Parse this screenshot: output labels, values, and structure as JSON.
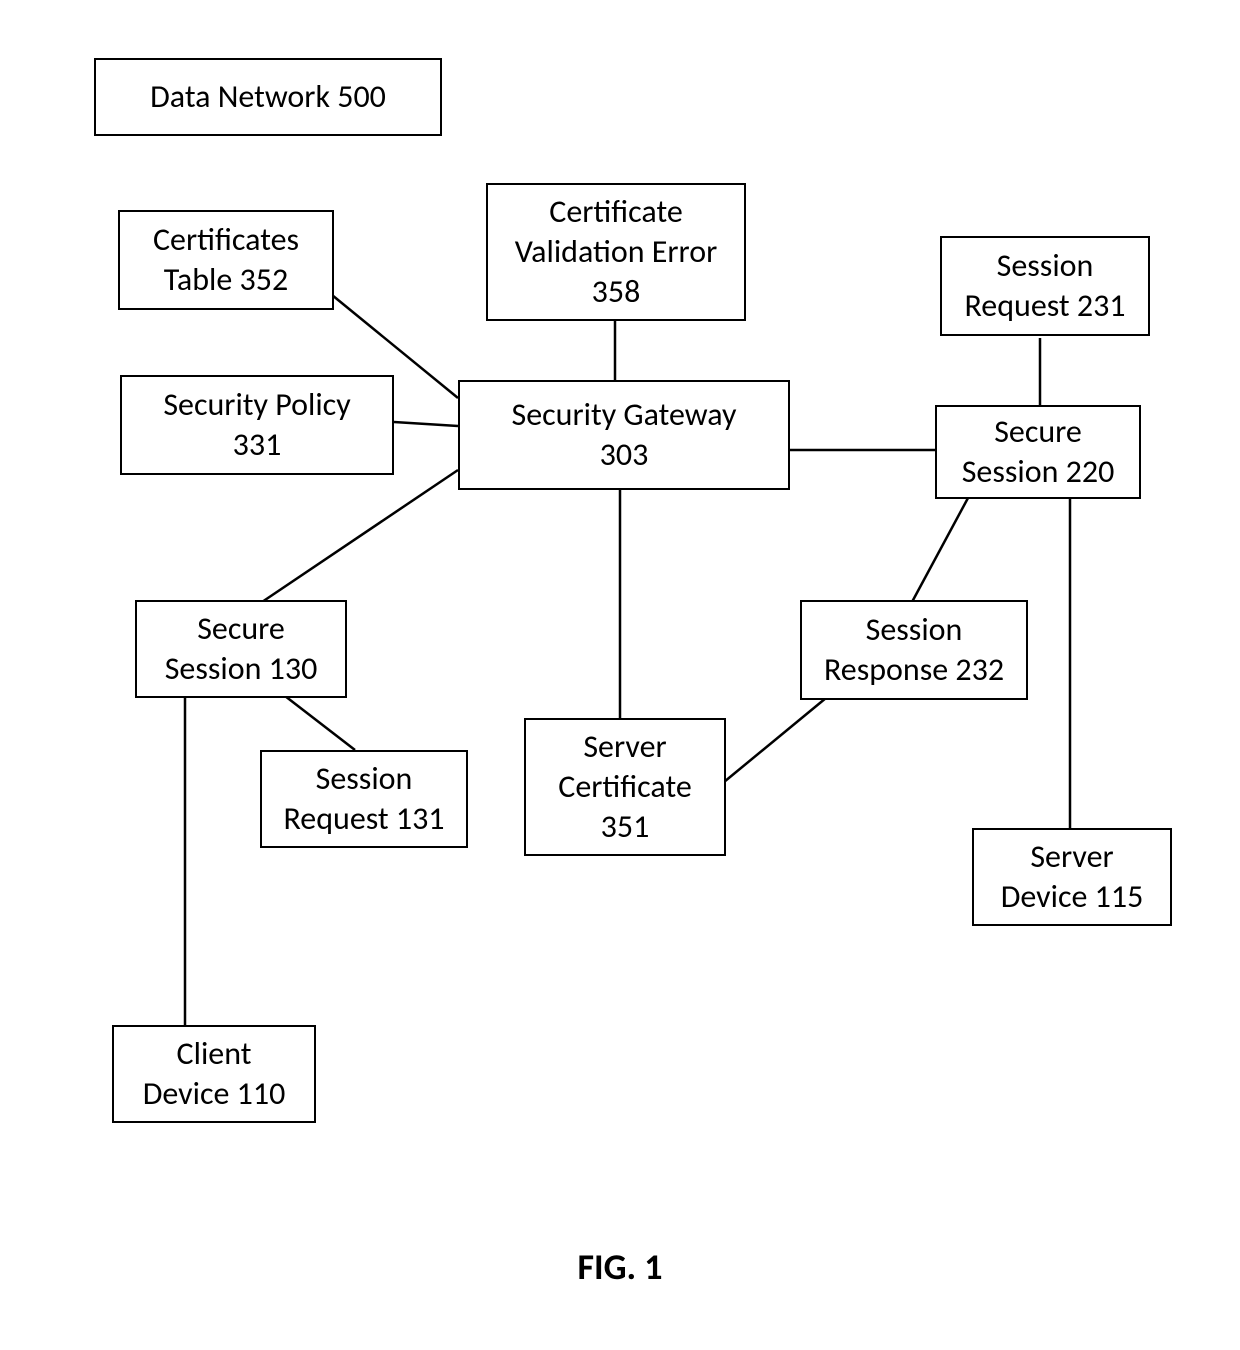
{
  "caption": "FIG. 1",
  "nodes": {
    "dataNetwork": {
      "line1": "Data Network 500"
    },
    "certTable": {
      "line1": "Certificates",
      "line2": "Table 352"
    },
    "certValErr": {
      "line1": "Certificate",
      "line2": "Validation Error",
      "line3": "358"
    },
    "sessReq231": {
      "line1": "Session",
      "line2": "Request 231"
    },
    "secPolicy": {
      "line1": "Security Policy",
      "line2": "331"
    },
    "secGateway": {
      "line1": "Security Gateway",
      "line2": "303"
    },
    "secSess220": {
      "line1": "Secure",
      "line2": "Session 220"
    },
    "secSess130": {
      "line1": "Secure",
      "line2": "Session 130"
    },
    "sessResp232": {
      "line1": "Session",
      "line2": "Response 232"
    },
    "sessReq131": {
      "line1": "Session",
      "line2": "Request 131"
    },
    "servCert": {
      "line1": "Server",
      "line2": "Certificate",
      "line3": "351"
    },
    "servDev": {
      "line1": "Server",
      "line2": "Device 115"
    },
    "clientDev": {
      "line1": "Client",
      "line2": "Device 110"
    }
  },
  "edges": [
    {
      "from": "certTable",
      "to": "secGateway"
    },
    {
      "from": "certValErr",
      "to": "secGateway"
    },
    {
      "from": "secPolicy",
      "to": "secGateway"
    },
    {
      "from": "secGateway",
      "to": "secSess220"
    },
    {
      "from": "sessReq231",
      "to": "secSess220"
    },
    {
      "from": "secGateway",
      "to": "secSess130"
    },
    {
      "from": "secGateway",
      "to": "servCert"
    },
    {
      "from": "secSess220",
      "to": "sessResp232"
    },
    {
      "from": "secSess220",
      "to": "servDev"
    },
    {
      "from": "sessResp232",
      "to": "servCert"
    },
    {
      "from": "secSess130",
      "to": "sessReq131"
    },
    {
      "from": "secSess130",
      "to": "clientDev"
    }
  ]
}
